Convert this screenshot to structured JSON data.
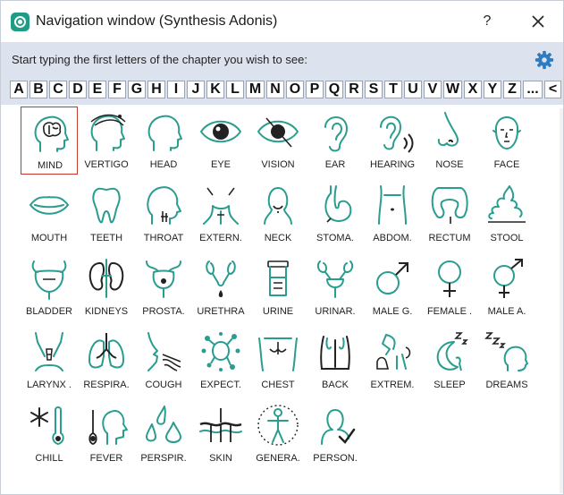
{
  "window": {
    "title": "Navigation window (Synthesis Adonis)",
    "help_label": "?",
    "close_icon": "close-icon",
    "app_icon": "synthesis-logo-icon"
  },
  "header": {
    "instruction": "Start typing the first letters of the chapter you wish to see:",
    "settings_icon": "gear-icon",
    "accent_color": "#2e7bbf"
  },
  "alphabet": [
    "A",
    "B",
    "C",
    "D",
    "E",
    "F",
    "G",
    "H",
    "I",
    "J",
    "K",
    "L",
    "M",
    "N",
    "O",
    "P",
    "Q",
    "R",
    "S",
    "T",
    "U",
    "V",
    "W",
    "X",
    "Y",
    "Z",
    "...",
    "<"
  ],
  "chapters": [
    {
      "label": "MIND",
      "icon": "brain-head-icon",
      "selected": true
    },
    {
      "label": "VERTIGO",
      "icon": "dizzy-head-icon"
    },
    {
      "label": "HEAD",
      "icon": "head-icon"
    },
    {
      "label": "EYE",
      "icon": "eye-icon"
    },
    {
      "label": "VISION",
      "icon": "crossed-eye-icon"
    },
    {
      "label": "EAR",
      "icon": "ear-icon"
    },
    {
      "label": "HEARING",
      "icon": "hearing-icon"
    },
    {
      "label": "NOSE",
      "icon": "nose-icon"
    },
    {
      "label": "FACE",
      "icon": "face-icon"
    },
    {
      "label": "MOUTH",
      "icon": "mouth-icon"
    },
    {
      "label": "TEETH",
      "icon": "tooth-icon"
    },
    {
      "label": "THROAT",
      "icon": "throat-icon"
    },
    {
      "label": "EXTERN.",
      "icon": "external-throat-icon"
    },
    {
      "label": "NECK",
      "icon": "neck-icon"
    },
    {
      "label": "STOMA.",
      "icon": "stomach-icon"
    },
    {
      "label": "ABDOM.",
      "icon": "abdomen-icon"
    },
    {
      "label": "RECTUM",
      "icon": "intestine-icon"
    },
    {
      "label": "STOOL",
      "icon": "stool-icon"
    },
    {
      "label": "BLADDER",
      "icon": "bladder-icon"
    },
    {
      "label": "KIDNEYS",
      "icon": "kidneys-icon"
    },
    {
      "label": "PROSTA.",
      "icon": "prostate-icon"
    },
    {
      "label": "URETHRA",
      "icon": "urethra-icon"
    },
    {
      "label": "URINE",
      "icon": "urine-sample-icon"
    },
    {
      "label": "URINAR.",
      "icon": "urinary-icon"
    },
    {
      "label": "MALE G.",
      "icon": "male-symbol-icon"
    },
    {
      "label": "FEMALE .",
      "icon": "female-symbol-icon"
    },
    {
      "label": "MALE A.",
      "icon": "male-female-symbol-icon"
    },
    {
      "label": "LARYNX .",
      "icon": "larynx-icon"
    },
    {
      "label": "RESPIRA.",
      "icon": "lungs-icon"
    },
    {
      "label": "COUGH",
      "icon": "cough-icon"
    },
    {
      "label": "EXPECT.",
      "icon": "splatter-icon"
    },
    {
      "label": "CHEST",
      "icon": "chest-icon"
    },
    {
      "label": "BACK",
      "icon": "back-icon"
    },
    {
      "label": "EXTREM.",
      "icon": "extremities-icon"
    },
    {
      "label": "SLEEP",
      "icon": "sleep-moon-icon"
    },
    {
      "label": "DREAMS",
      "icon": "dreams-icon"
    },
    {
      "label": "CHILL",
      "icon": "snowflake-thermometer-icon"
    },
    {
      "label": "FEVER",
      "icon": "fever-icon"
    },
    {
      "label": "PERSPIR.",
      "icon": "drops-icon"
    },
    {
      "label": "SKIN",
      "icon": "skin-icon"
    },
    {
      "label": "GENERA.",
      "icon": "body-icon"
    },
    {
      "label": "PERSON.",
      "icon": "person-check-icon"
    }
  ]
}
